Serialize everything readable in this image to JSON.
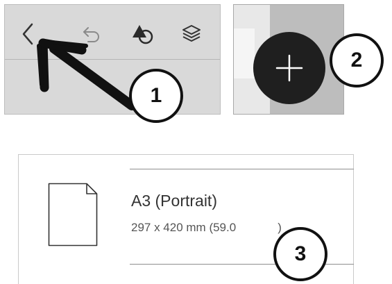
{
  "toolbar": {
    "tools": [
      {
        "icon": "back-chevron-icon"
      },
      {
        "icon": "undo-icon"
      },
      {
        "icon": "shapes-icon"
      },
      {
        "icon": "layers-icon"
      }
    ]
  },
  "add_button": {
    "icon": "plus-icon"
  },
  "paper": {
    "name": "A3 (Portrait)",
    "dims_shown": "297 x 420 mm (59.0",
    "dims_tail": ")"
  },
  "callouts": {
    "one": "1",
    "two": "2",
    "three": "3"
  },
  "colors": {
    "toolbar_bg": "#d9d9d9",
    "button_bg": "#1f1f1f",
    "callout_border": "#111111"
  }
}
